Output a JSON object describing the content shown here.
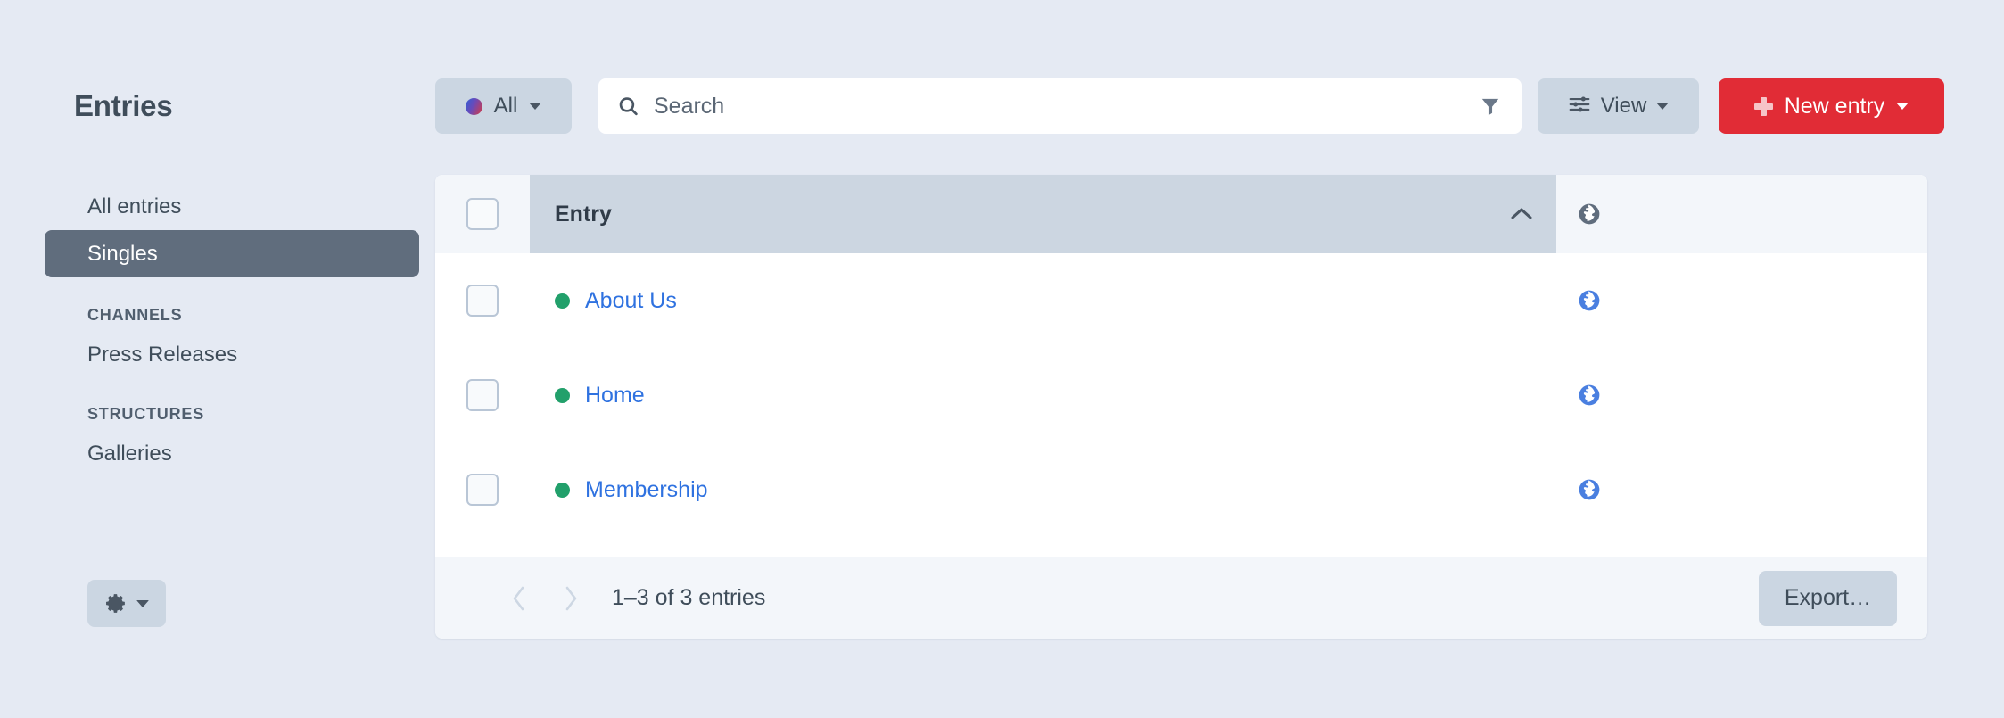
{
  "sidebar": {
    "title": "Entries",
    "items": [
      {
        "label": "All entries",
        "selected": false
      },
      {
        "label": "Singles",
        "selected": true
      }
    ],
    "groups": [
      {
        "heading": "CHANNELS",
        "items": [
          "Press Releases"
        ]
      },
      {
        "heading": "STRUCTURES",
        "items": [
          "Galleries"
        ]
      }
    ],
    "settings_button": {
      "icon": "gear-icon",
      "caret": "chevron-down-icon"
    }
  },
  "toolbar": {
    "status_filter": {
      "label": "All",
      "dot_colors": [
        "#2f5fd8",
        "#d93a40"
      ],
      "caret": "chevron-down-icon"
    },
    "search": {
      "placeholder": "Search",
      "value": "",
      "icon": "search-icon",
      "filter_icon": "filter-icon"
    },
    "view_button": {
      "label": "View",
      "icon": "sliders-icon",
      "caret": "chevron-down-icon"
    },
    "new_entry_button": {
      "label": "New entry",
      "icon": "plus-icon",
      "caret": "chevron-down-icon",
      "color": "#e12c36"
    }
  },
  "table": {
    "select_all_checkbox": {
      "checked": false
    },
    "columns": [
      {
        "key": "entry",
        "label": "Entry",
        "sorted": true,
        "sort_direction": "asc",
        "sort_icon": "chevron-up-icon"
      },
      {
        "key": "site",
        "label": "",
        "icon": "globe-icon",
        "icon_color": "#606d7d"
      }
    ],
    "rows": [
      {
        "checked": false,
        "status_color": "#22a06b",
        "title": "About Us",
        "site_icon": "globe-icon",
        "site_icon_color": "#4a7fe0"
      },
      {
        "checked": false,
        "status_color": "#22a06b",
        "title": "Home",
        "site_icon": "globe-icon",
        "site_icon_color": "#4a7fe0"
      },
      {
        "checked": false,
        "status_color": "#22a06b",
        "title": "Membership",
        "site_icon": "globe-icon",
        "site_icon_color": "#4a7fe0"
      }
    ]
  },
  "footer": {
    "prev_label": "‹",
    "next_label": "›",
    "pagination_info": "1–3 of 3 entries",
    "export_label": "Export…"
  }
}
